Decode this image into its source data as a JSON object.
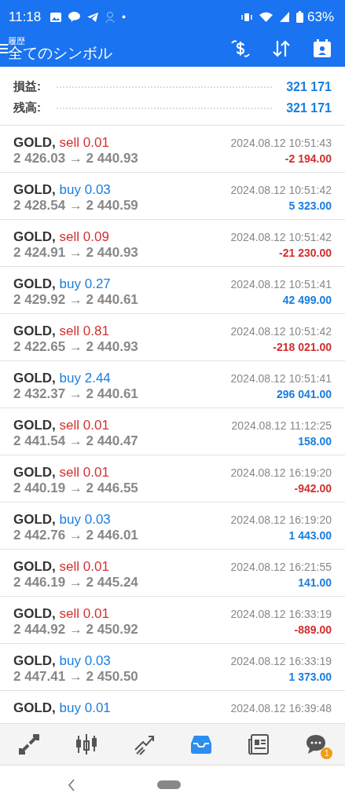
{
  "status_bar": {
    "time": "11:18",
    "battery": "63%"
  },
  "header": {
    "subtitle": "履歴",
    "title": "全てのシンボル"
  },
  "summary": [
    {
      "label": "損益:",
      "value": "321 171"
    },
    {
      "label": "残高:",
      "value": "321 171"
    }
  ],
  "deals": [
    {
      "symbol": "GOLD,",
      "kind": "sell",
      "order": "sell 0.01",
      "prices": "2 426.03 → 2 440.93",
      "time": "2024.08.12 10:51:43",
      "profit": "-2 194.00",
      "loss": true
    },
    {
      "symbol": "GOLD,",
      "kind": "buy",
      "order": "buy 0.03",
      "prices": "2 428.54 → 2 440.59",
      "time": "2024.08.12 10:51:42",
      "profit": "5 323.00",
      "loss": false
    },
    {
      "symbol": "GOLD,",
      "kind": "sell",
      "order": "sell 0.09",
      "prices": "2 424.91 → 2 440.93",
      "time": "2024.08.12 10:51:42",
      "profit": "-21 230.00",
      "loss": true
    },
    {
      "symbol": "GOLD,",
      "kind": "buy",
      "order": "buy 0.27",
      "prices": "2 429.92 → 2 440.61",
      "time": "2024.08.12 10:51:41",
      "profit": "42 499.00",
      "loss": false
    },
    {
      "symbol": "GOLD,",
      "kind": "sell",
      "order": "sell 0.81",
      "prices": "2 422.65 → 2 440.93",
      "time": "2024.08.12 10:51:42",
      "profit": "-218 021.00",
      "loss": true
    },
    {
      "symbol": "GOLD,",
      "kind": "buy",
      "order": "buy 2.44",
      "prices": "2 432.37 → 2 440.61",
      "time": "2024.08.12 10:51:41",
      "profit": "296 041.00",
      "loss": false
    },
    {
      "symbol": "GOLD,",
      "kind": "sell",
      "order": "sell 0.01",
      "prices": "2 441.54 → 2 440.47",
      "time": "2024.08.12 11:12:25",
      "profit": "158.00",
      "loss": false
    },
    {
      "symbol": "GOLD,",
      "kind": "sell",
      "order": "sell 0.01",
      "prices": "2 440.19 → 2 446.55",
      "time": "2024.08.12 16:19:20",
      "profit": "-942.00",
      "loss": true
    },
    {
      "symbol": "GOLD,",
      "kind": "buy",
      "order": "buy 0.03",
      "prices": "2 442.76 → 2 446.01",
      "time": "2024.08.12 16:19:20",
      "profit": "1 443.00",
      "loss": false
    },
    {
      "symbol": "GOLD,",
      "kind": "sell",
      "order": "sell 0.01",
      "prices": "2 446.19 → 2 445.24",
      "time": "2024.08.12 16:21:55",
      "profit": "141.00",
      "loss": false
    },
    {
      "symbol": "GOLD,",
      "kind": "sell",
      "order": "sell 0.01",
      "prices": "2 444.92 → 2 450.92",
      "time": "2024.08.12 16:33:19",
      "profit": "-889.00",
      "loss": true
    },
    {
      "symbol": "GOLD,",
      "kind": "buy",
      "order": "buy 0.03",
      "prices": "2 447.41 → 2 450.50",
      "time": "2024.08.12 16:33:19",
      "profit": "1 373.00",
      "loss": false
    },
    {
      "symbol": "GOLD,",
      "kind": "buy",
      "order": "buy 0.01",
      "time": "2024.08.12 16:39:48"
    }
  ],
  "bottom_nav": [
    {
      "kind": "quotes",
      "selected": false
    },
    {
      "kind": "chart",
      "selected": false
    },
    {
      "kind": "trade",
      "selected": false
    },
    {
      "kind": "history",
      "selected": true
    },
    {
      "kind": "news",
      "selected": false
    },
    {
      "kind": "chat",
      "selected": false,
      "badge": "1"
    }
  ]
}
